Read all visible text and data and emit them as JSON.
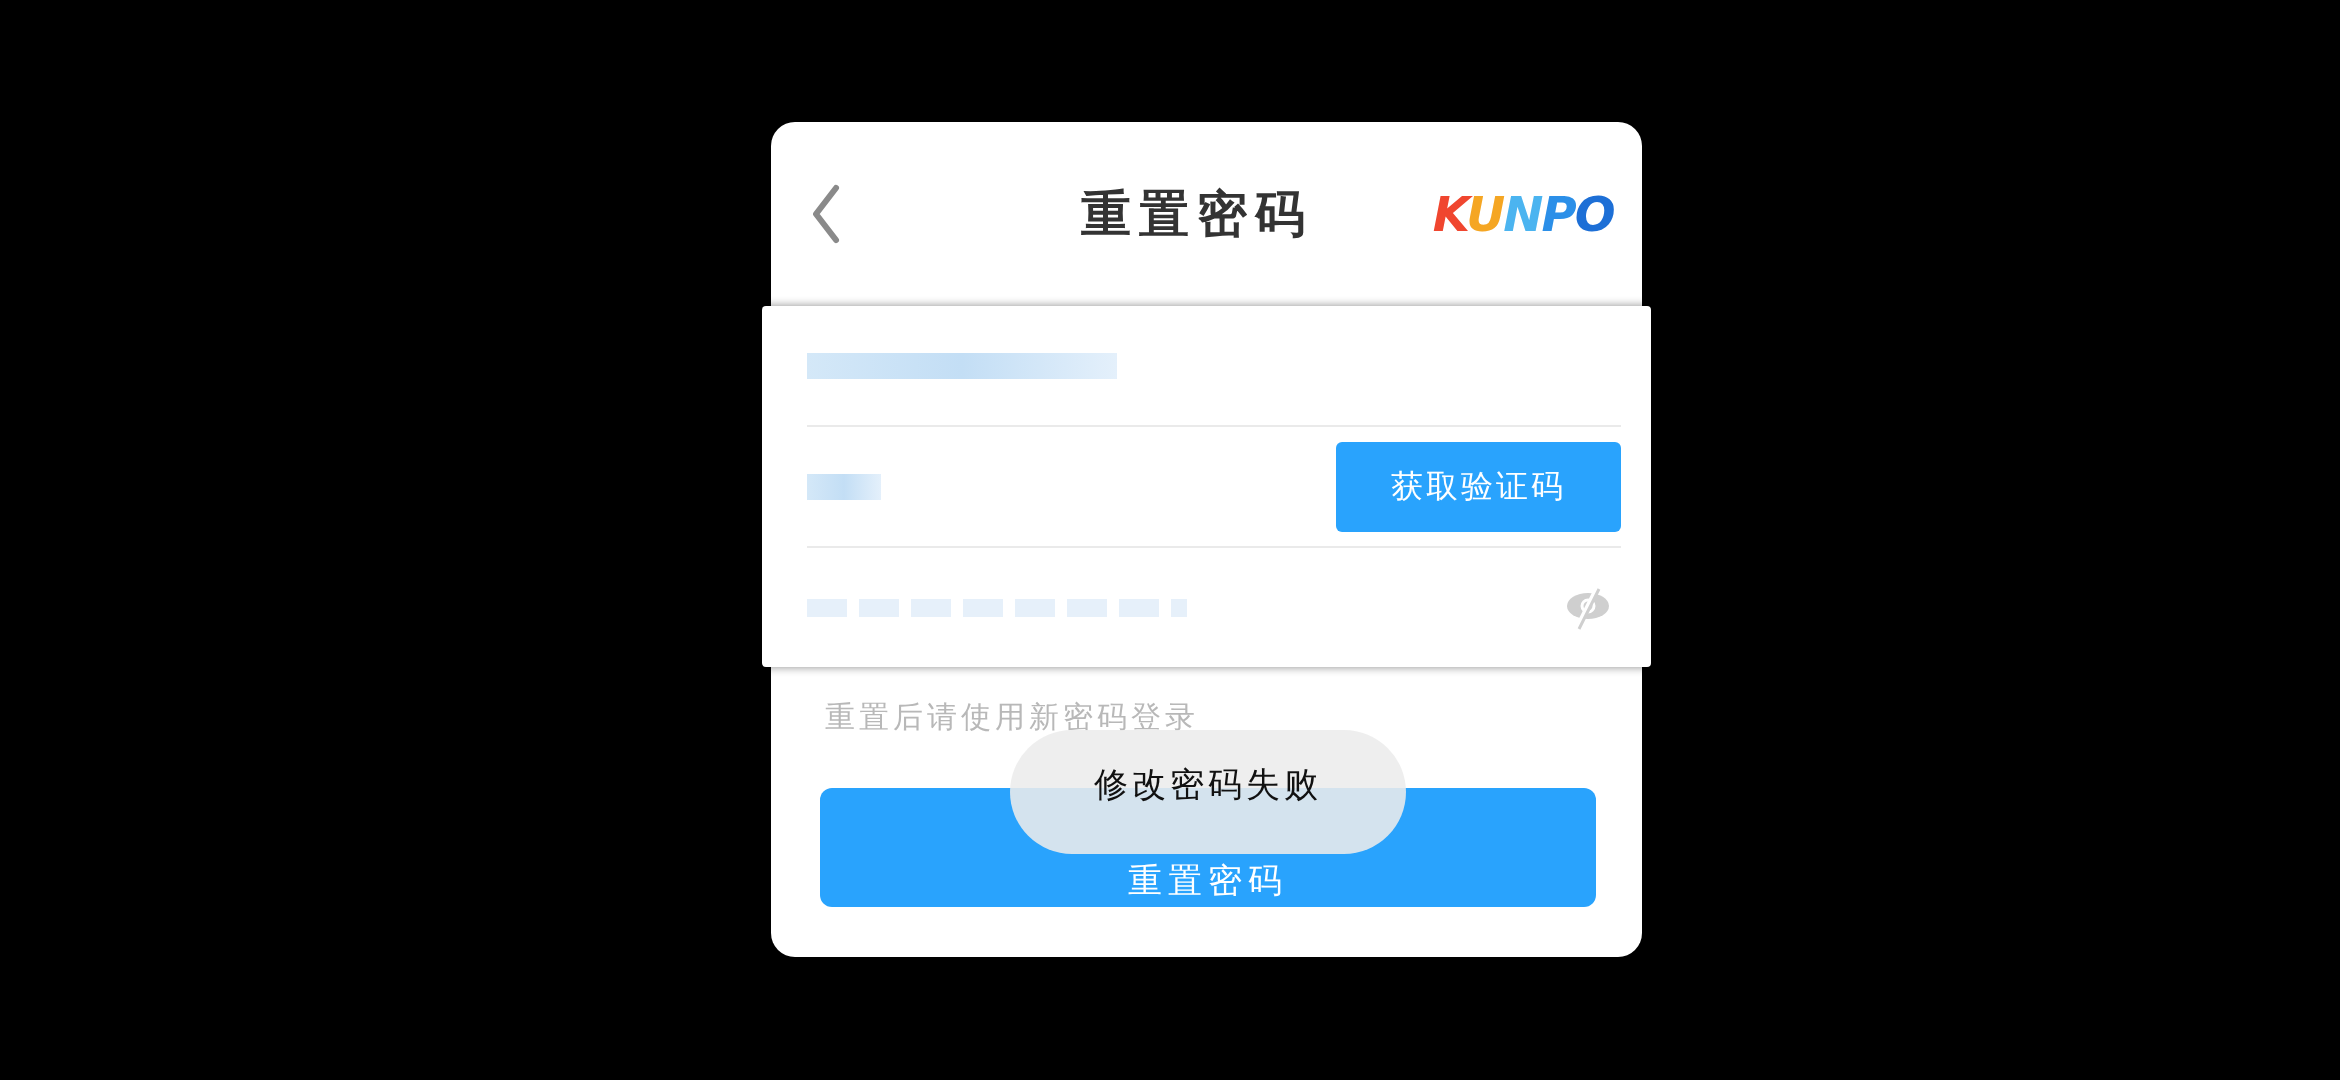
{
  "header": {
    "title": "重置密码",
    "logo": "KUNPO"
  },
  "fields": [
    {
      "kind": "text",
      "redacted": true
    },
    {
      "kind": "code",
      "redacted": true,
      "button": "获取验证码"
    },
    {
      "kind": "password",
      "redacted": true,
      "visible": false
    }
  ],
  "hint": "重置后请使用新密码登录",
  "submit_button": "重置密码",
  "toast": "修改密码失败"
}
